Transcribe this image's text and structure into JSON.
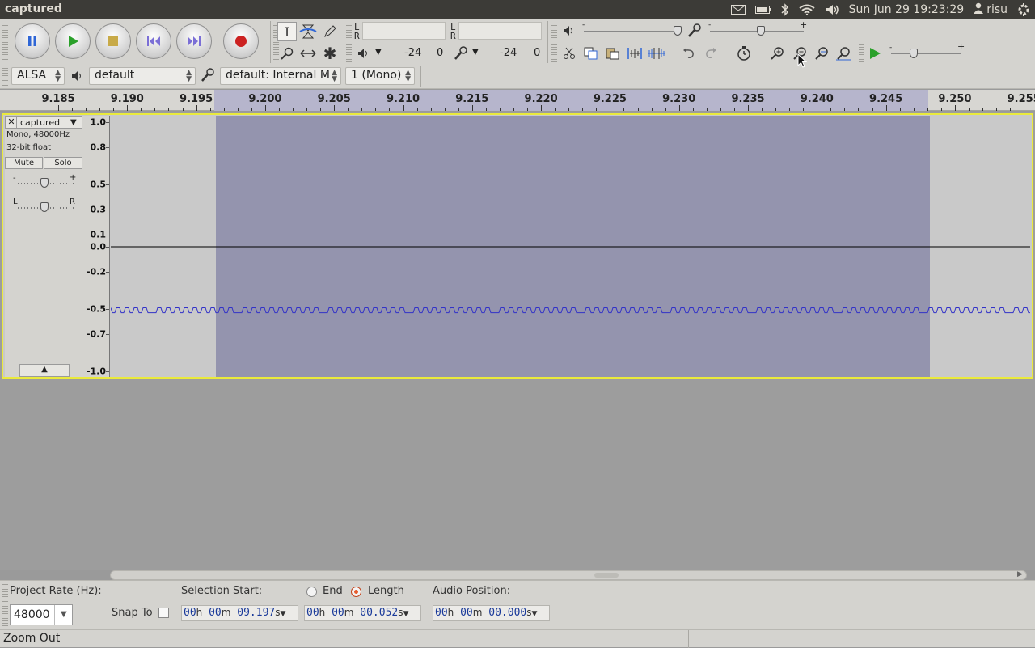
{
  "window": {
    "title": "captured"
  },
  "tray": {
    "clock": "Sun Jun 29 19:23:29",
    "user": "risu"
  },
  "meters": {
    "play": {
      "l": "L",
      "r": "R",
      "vol_low": "-24",
      "vol_high": "0"
    },
    "rec": {
      "l": "L",
      "r": "R",
      "vol_low": "-24",
      "vol_high": "0"
    }
  },
  "device": {
    "host": "ALSA",
    "output": "default",
    "input": "default: Internal M",
    "channels": "1 (Mono)"
  },
  "ruler": {
    "ticks": [
      "9.185",
      "9.190",
      "9.195",
      "9.200",
      "9.205",
      "9.210",
      "9.215",
      "9.220",
      "9.225",
      "9.230",
      "9.235",
      "9.240",
      "9.245",
      "9.250",
      "9.255"
    ]
  },
  "track": {
    "name": "captured",
    "info1": "Mono, 48000Hz",
    "info2": "32-bit float",
    "mute": "Mute",
    "solo": "Solo",
    "gain_minus": "-",
    "gain_plus": "+",
    "pan_l": "L",
    "pan_r": "R",
    "vlabels": [
      "1.0",
      "0.8",
      "0.5",
      "0.3",
      "0.1",
      "0.0",
      "-0.2",
      "-0.5",
      "-0.7",
      "-1.0"
    ]
  },
  "selection": {
    "project_rate_label": "Project Rate (Hz):",
    "project_rate": "48000",
    "snap_label": "Snap To",
    "sel_start_label": "Selection Start:",
    "end_label": "End",
    "length_label": "Length",
    "audio_pos_label": "Audio Position:",
    "start": {
      "h": "00",
      "m": "00",
      "s": "09.197"
    },
    "length": {
      "h": "00",
      "m": "00",
      "s": "00.052"
    },
    "position": {
      "h": "00",
      "m": "00",
      "s": "00.000"
    },
    "h_unit": "h",
    "m_unit": "m",
    "s_unit": "s"
  },
  "status": {
    "text": "Zoom Out"
  },
  "colors": {
    "selection": "#9494ae",
    "waveform": "#3232c8",
    "track_border": "#eaea3c",
    "record": "#cc2222",
    "play": "#2aa02a"
  }
}
